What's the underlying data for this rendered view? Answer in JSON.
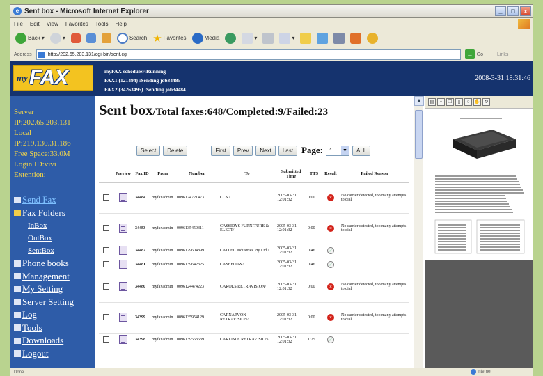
{
  "window": {
    "title": "Sent box - Microsoft Internet Explorer",
    "min": "_",
    "max": "□",
    "close": "x"
  },
  "menu": [
    "File",
    "Edit",
    "View",
    "Favorites",
    "Tools",
    "Help"
  ],
  "toolbar": {
    "back": "Back",
    "search": "Search",
    "favorites": "Favorites",
    "media": "Media"
  },
  "address": {
    "label": "Address",
    "url": "http://202.65.203.131/cgi-bin/sent.cgi",
    "go": "Go",
    "links": "Links"
  },
  "header": {
    "logo_my": "my",
    "logo_fax": "FAX",
    "status": [
      "myFAX scheduler:Running",
      "FAX1 (121494)    :Sending job34485",
      "FAX2 (34263495) :Sending job34484"
    ],
    "datetime": "2008-3-31 18:31:46"
  },
  "info": {
    "server_label": "Server",
    "server_ip": "IP:202.65.203.131",
    "local_label": "Local",
    "local_ip": "IP:219.130.31.186",
    "free_space": "Free Space:33.0M",
    "login_id": "Login ID:vivi",
    "extension": "Extention:"
  },
  "nav": [
    {
      "label": "Send Fax",
      "sub": false,
      "color": "#7ec0ff"
    },
    {
      "label": "Fax Folders",
      "sub": false,
      "color": "#ffffff"
    },
    {
      "label": "InBox",
      "sub": true,
      "color": "#ffffff"
    },
    {
      "label": "OutBox",
      "sub": true,
      "color": "#ffffff"
    },
    {
      "label": "SentBox",
      "sub": true,
      "color": "#ffffff"
    },
    {
      "label": "Phone books",
      "sub": false,
      "color": "#ffffff"
    },
    {
      "label": "Management",
      "sub": false,
      "color": "#ffffff"
    },
    {
      "label": "My Setting",
      "sub": false,
      "color": "#ffffff"
    },
    {
      "label": "Server Setting",
      "sub": false,
      "color": "#ffffff"
    },
    {
      "label": "Log",
      "sub": false,
      "color": "#ffffff"
    },
    {
      "label": "Tools",
      "sub": false,
      "color": "#ffffff"
    },
    {
      "label": "Downloads",
      "sub": false,
      "color": "#ffffff"
    },
    {
      "label": "Logout",
      "sub": false,
      "color": "#ffffff"
    }
  ],
  "main": {
    "title": "Sent box",
    "stats": "/Total faxes:648/Completed:9/Failed:23",
    "buttons": {
      "select": "Select",
      "delete": "Delete",
      "first": "First",
      "prev": "Prev",
      "next": "Next",
      "last": "Last",
      "all": "ALL"
    },
    "page_label": "Page:",
    "page_value": "1"
  },
  "table": {
    "headers": [
      "Preview",
      "Fax ID",
      "From",
      "Number",
      "To",
      "Submitted Time",
      "TTS",
      "Result",
      "Failed Reason"
    ],
    "rows": [
      {
        "id": "34484",
        "from": "myfaxadmin",
        "number": "0096124721473",
        "to": "CCS /",
        "time": "2005-03-31 12:01:32",
        "tts": "0:00",
        "result": "fail",
        "reason": "No carrier detected, too many attempts to dial"
      },
      {
        "id": "34483",
        "from": "myfaxadmin",
        "number": "0096135450311",
        "to": "CASSIDYS FURNITURE & ELECT/",
        "time": "2005-03-31 12:01:32",
        "tts": "0:00",
        "result": "fail",
        "reason": "No carrier detected, too many attempts to dial"
      },
      {
        "id": "34482",
        "from": "myfaxadmin",
        "number": "0096129604899",
        "to": "CATLEC Industries Pty Ltd /",
        "time": "2005-03-31 12:01:32",
        "tts": "0:46",
        "result": "ok",
        "reason": ""
      },
      {
        "id": "34481",
        "from": "myfaxadmin",
        "number": "0096139642325",
        "to": "CASEFLOW/",
        "time": "2005-03-31 12:01:32",
        "tts": "0:46",
        "result": "ok",
        "reason": ""
      },
      {
        "id": "34480",
        "from": "myfaxadmin",
        "number": "0096124474223",
        "to": "CAROLS RETRAVISION/",
        "time": "2005-03-31 12:01:32",
        "tts": "0:00",
        "result": "fail",
        "reason": "No carrier detected, too many attempts to dial"
      },
      {
        "id": "34399",
        "from": "myfaxadmin",
        "number": "0096135954129",
        "to": "CARNARVON RETRAVISION/",
        "time": "2005-03-31 12:01:32",
        "tts": "0:00",
        "result": "fail",
        "reason": "No carrier detected, too many attempts to dial"
      },
      {
        "id": "34398",
        "from": "myfaxadmin",
        "number": "0096139563639",
        "to": "CARLISLE RETRAVISION/",
        "time": "2005-03-31 12:01:32",
        "tts": "1:25",
        "result": "ok",
        "reason": ""
      }
    ]
  },
  "statusbar": {
    "left": "Done",
    "zone": "Internet"
  },
  "colors": {
    "header_bg": "#15336e",
    "sidebar_bg": "#2e5ca8",
    "info_text": "#f2d54a",
    "logo_bg": "#f3c320",
    "fail": "#d3231a"
  }
}
